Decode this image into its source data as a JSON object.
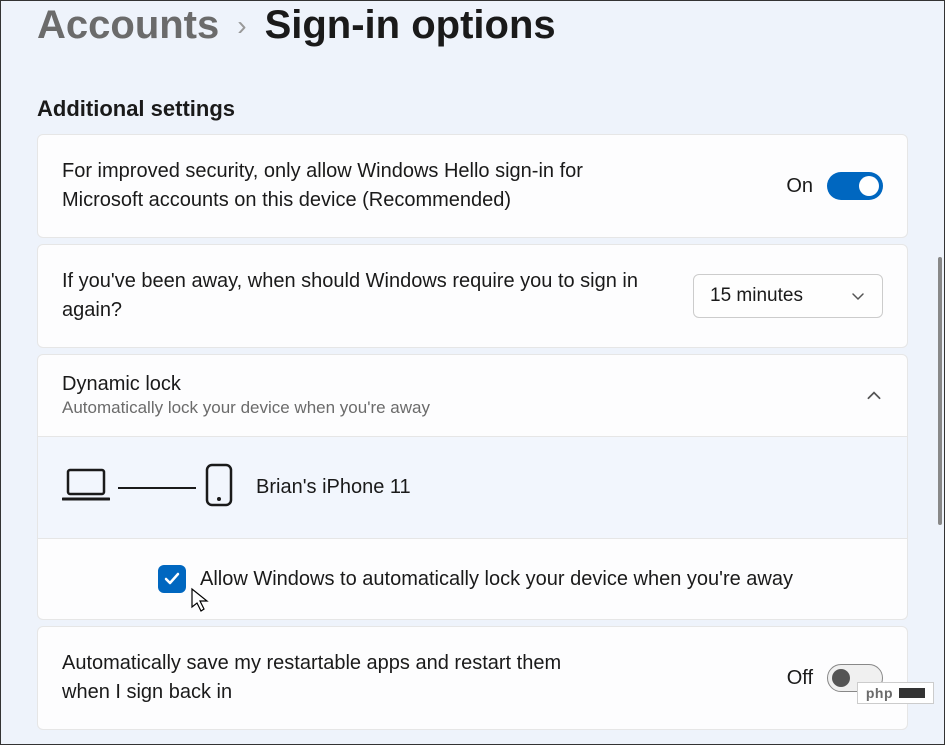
{
  "breadcrumb": {
    "parent": "Accounts",
    "current": "Sign-in options"
  },
  "section_heading": "Additional settings",
  "hello_card": {
    "text": "For improved security, only allow Windows Hello sign-in for Microsoft accounts on this device (Recommended)",
    "state_label": "On",
    "state": true
  },
  "away_card": {
    "text": "If you've been away, when should Windows require you to sign in again?",
    "selected": "15 minutes"
  },
  "dynamic_lock": {
    "title": "Dynamic lock",
    "subtitle": "Automatically lock your device when you're away",
    "device_name": "Brian's iPhone 11",
    "checkbox_label": "Allow Windows to automatically lock your device when you're away",
    "checkbox_checked": true
  },
  "restart_apps": {
    "text": "Automatically save my restartable apps and restart them when I sign back in",
    "state_label": "Off",
    "state": false
  },
  "watermark": "php"
}
